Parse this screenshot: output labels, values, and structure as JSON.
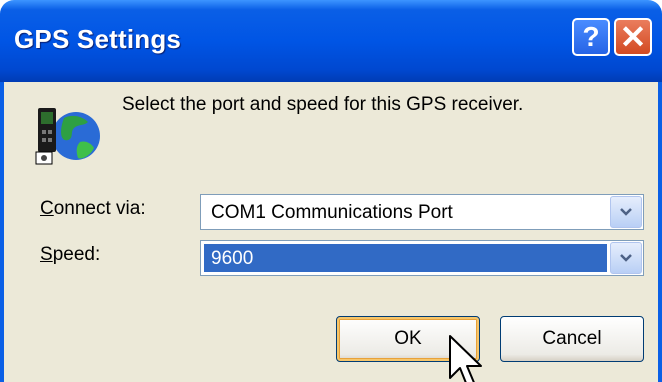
{
  "window": {
    "title": "GPS Settings"
  },
  "titlebar": {
    "help_glyph": "?",
    "close_glyph": "✕"
  },
  "dialog": {
    "prompt": "Select the port and speed for this GPS receiver.",
    "connect_via": {
      "accel": "C",
      "rest": "onnect via:",
      "value": "COM1 Communications Port"
    },
    "speed": {
      "accel": "S",
      "rest": "peed:",
      "value": "9600"
    },
    "icons": {
      "gps": "gps-globe-icon",
      "dropdown": "chevron-down-icon",
      "cursor": "mouse-pointer-icon"
    }
  },
  "buttons": {
    "ok": "OK",
    "cancel": "Cancel"
  },
  "colors": {
    "titlebar": "#0055e5",
    "body": "#ece9d8",
    "selection": "#316ac5"
  }
}
